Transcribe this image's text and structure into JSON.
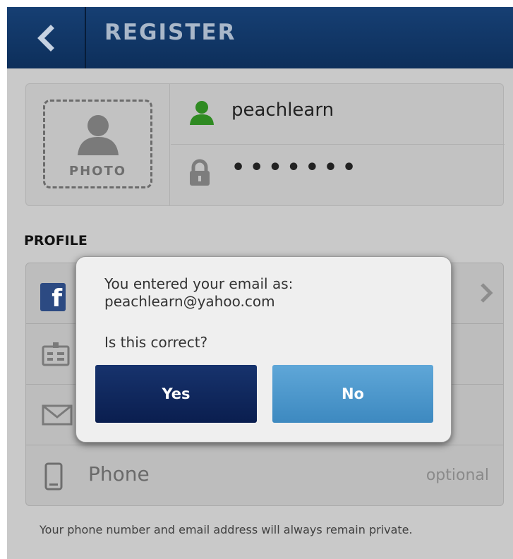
{
  "header": {
    "title": "REGISTER",
    "back_icon": "chevron-left-icon"
  },
  "account": {
    "photo_label": "PHOTO",
    "username": "peachlearn",
    "password_mask": "•••••••",
    "username_icon": "user-icon",
    "password_icon": "lock-icon"
  },
  "profile": {
    "section_label": "PROFILE",
    "facebook_icon_letter": "f",
    "phone_label": "Phone",
    "phone_hint": "optional"
  },
  "privacy_note": "Your phone number and email address will always remain private.",
  "dialog": {
    "message_line1": "You entered your email as:",
    "message_line2": "peachlearn@yahoo.com",
    "question": "Is this correct?",
    "yes_label": "Yes",
    "no_label": "No"
  },
  "colors": {
    "header_bg": "#163f73",
    "user_icon_green": "#2f8a22",
    "yes_button": "#0f2a5e",
    "no_button": "#4f9bd0"
  }
}
